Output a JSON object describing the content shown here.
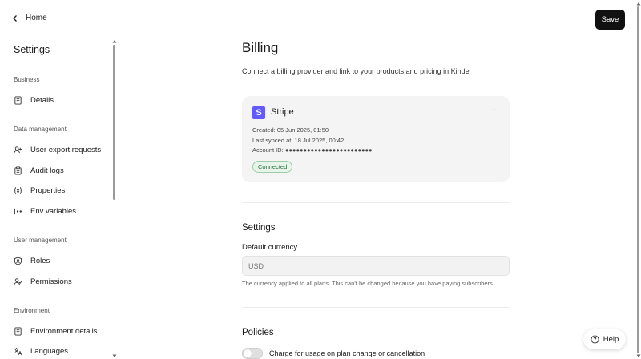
{
  "nav": {
    "home_label": "Home",
    "title": "Settings",
    "sections": [
      {
        "label": "Business",
        "items": [
          {
            "label": "Details",
            "icon": "document-icon"
          }
        ]
      },
      {
        "label": "Data management",
        "items": [
          {
            "label": "User export requests",
            "icon": "user-export-icon"
          },
          {
            "label": "Audit logs",
            "icon": "clipboard-icon"
          },
          {
            "label": "Properties",
            "icon": "variable-icon"
          },
          {
            "label": "Env variables",
            "icon": "env-variables-icon"
          }
        ]
      },
      {
        "label": "User management",
        "items": [
          {
            "label": "Roles",
            "icon": "shield-icon"
          },
          {
            "label": "Permissions",
            "icon": "user-check-icon"
          }
        ]
      },
      {
        "label": "Environment",
        "items": [
          {
            "label": "Environment details",
            "icon": "document-icon"
          },
          {
            "label": "Languages",
            "icon": "translate-icon"
          }
        ]
      }
    ]
  },
  "header": {
    "save_label": "Save"
  },
  "page": {
    "title": "Billing",
    "subtitle": "Connect a billing provider and link to your products and pricing in Kinde"
  },
  "provider": {
    "logo_letter": "S",
    "name": "Stripe",
    "more": "···",
    "created": "Created: 05 Jun 2025, 01:50",
    "last_synced": "Last synced at: 18 Jul 2025, 00:42",
    "account_id": "Account ID: ●●●●●●●●●●●●●●●●●●●●●●●●",
    "status": "Connected",
    "brand_color": "#635bff"
  },
  "settings": {
    "title": "Settings",
    "currency_label": "Default currency",
    "currency_placeholder": "USD",
    "currency_help": "The currency applied to all plans. This can't be changed because you have paying subscribers."
  },
  "policies": {
    "title": "Policies",
    "charge_toggle_label": "Charge for usage on plan change or cancellation",
    "charge_toggle_on": false
  },
  "help": {
    "label": "Help"
  }
}
